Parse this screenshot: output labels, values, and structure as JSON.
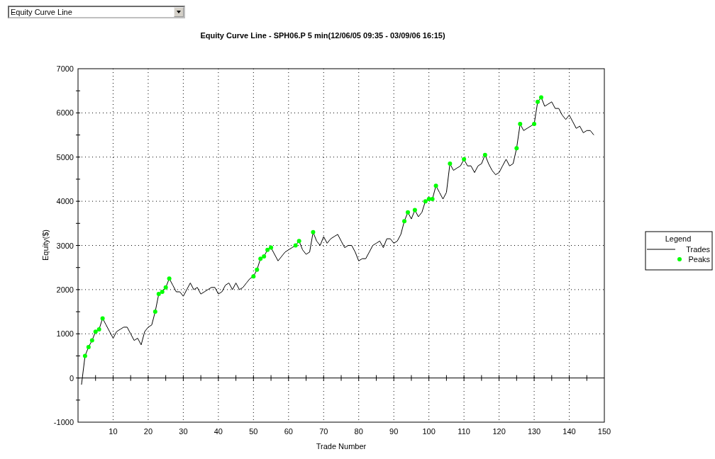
{
  "dropdown": {
    "value": "Equity Curve Line"
  },
  "chart": {
    "chart_data": {
      "type": "line",
      "legend": {
        "title": "Legend"
      },
      "title": "Equity Curve Line - SPH06.P 5 min(12/06/05 09:35 - 03/09/06 16:15)",
      "xlabel": "Trade Number",
      "ylabel": "Equity($)",
      "x": [
        1,
        2,
        3,
        4,
        5,
        6,
        7,
        8,
        9,
        10,
        11,
        12,
        13,
        14,
        15,
        16,
        17,
        18,
        19,
        20,
        21,
        22,
        23,
        24,
        25,
        26,
        27,
        28,
        29,
        30,
        31,
        32,
        33,
        34,
        35,
        36,
        37,
        38,
        39,
        40,
        41,
        42,
        43,
        44,
        45,
        46,
        47,
        48,
        49,
        50,
        51,
        52,
        53,
        54,
        55,
        56,
        57,
        58,
        59,
        60,
        61,
        62,
        63,
        64,
        65,
        66,
        67,
        68,
        69,
        70,
        71,
        72,
        73,
        74,
        75,
        76,
        77,
        78,
        79,
        80,
        81,
        82,
        83,
        84,
        85,
        86,
        87,
        88,
        89,
        90,
        91,
        92,
        93,
        94,
        95,
        96,
        97,
        98,
        99,
        100,
        101,
        102,
        103,
        104,
        105,
        106,
        107,
        108,
        109,
        110,
        111,
        112,
        113,
        114,
        115,
        116,
        117,
        118,
        119,
        120,
        121,
        122,
        123,
        124,
        125,
        126,
        127,
        128,
        129,
        130,
        131,
        132,
        133,
        134,
        135,
        136,
        137,
        138,
        139,
        140,
        141,
        142,
        143,
        144,
        145,
        146,
        147
      ],
      "grid": true,
      "xlim": [
        0,
        150
      ],
      "ylim": [
        -1000,
        7000
      ],
      "xticks": [
        10,
        20,
        30,
        40,
        50,
        60,
        70,
        80,
        90,
        100,
        110,
        120,
        130,
        140,
        150
      ],
      "yticks": [
        -1000,
        0,
        1000,
        2000,
        3000,
        4000,
        5000,
        6000,
        7000
      ],
      "series": [
        {
          "name": "Trades",
          "color": "#000000",
          "values": [
            -150,
            500,
            700,
            850,
            1050,
            1100,
            1350,
            1200,
            1050,
            900,
            1050,
            1100,
            1150,
            1150,
            1000,
            850,
            900,
            750,
            1050,
            1150,
            1200,
            1500,
            1900,
            1950,
            2050,
            2250,
            2100,
            1950,
            1950,
            1850,
            2000,
            2150,
            2000,
            2050,
            1900,
            1950,
            2000,
            2050,
            2050,
            1900,
            1950,
            2100,
            2150,
            2000,
            2150,
            2000,
            2050,
            2150,
            2250,
            2300,
            2450,
            2700,
            2750,
            2900,
            2950,
            2800,
            2650,
            2750,
            2850,
            2900,
            2950,
            3000,
            3100,
            2900,
            2800,
            2850,
            3300,
            3100,
            3000,
            3200,
            3050,
            3150,
            3200,
            3250,
            3100,
            2950,
            3000,
            3000,
            2850,
            2650,
            2700,
            2700,
            2850,
            3000,
            3050,
            3100,
            2950,
            3150,
            3150,
            3050,
            3100,
            3250,
            3550,
            3750,
            3600,
            3800,
            3650,
            3750,
            4000,
            4050,
            4050,
            4350,
            4200,
            4050,
            4200,
            4850,
            4700,
            4750,
            4800,
            4950,
            4800,
            4800,
            4650,
            4800,
            4850,
            5050,
            4850,
            4700,
            4600,
            4650,
            4800,
            4950,
            4800,
            4850,
            5200,
            5750,
            5600,
            5650,
            5700,
            5750,
            6250,
            6350,
            6150,
            6200,
            6250,
            6100,
            6100,
            5950,
            5850,
            5950,
            5800,
            5650,
            5700,
            5550,
            5600,
            5600,
            5500
          ]
        },
        {
          "name": "Peaks",
          "type": "scatter",
          "color": "#00ff00",
          "values": [
            null,
            500,
            700,
            850,
            1050,
            1100,
            1350,
            null,
            null,
            null,
            null,
            null,
            null,
            null,
            null,
            null,
            null,
            null,
            null,
            null,
            null,
            1500,
            1900,
            1950,
            2050,
            2250,
            null,
            null,
            null,
            null,
            null,
            null,
            null,
            null,
            null,
            null,
            null,
            null,
            null,
            null,
            null,
            null,
            null,
            null,
            null,
            null,
            null,
            null,
            null,
            2300,
            2450,
            2700,
            2750,
            2900,
            2950,
            null,
            null,
            null,
            null,
            null,
            null,
            3000,
            3100,
            null,
            null,
            null,
            3300,
            null,
            null,
            null,
            null,
            null,
            null,
            null,
            null,
            null,
            null,
            null,
            null,
            null,
            null,
            null,
            null,
            null,
            null,
            null,
            null,
            null,
            null,
            null,
            null,
            null,
            3550,
            3750,
            null,
            3800,
            null,
            null,
            4000,
            4050,
            4050,
            4350,
            null,
            null,
            null,
            4850,
            null,
            null,
            null,
            4950,
            null,
            null,
            null,
            null,
            null,
            5050,
            null,
            null,
            null,
            null,
            null,
            null,
            null,
            null,
            5200,
            5750,
            null,
            null,
            null,
            5750,
            6250,
            6350,
            null,
            null,
            null,
            null,
            null,
            null,
            null,
            null,
            null,
            null,
            null,
            null,
            null,
            null,
            null
          ]
        }
      ]
    }
  }
}
